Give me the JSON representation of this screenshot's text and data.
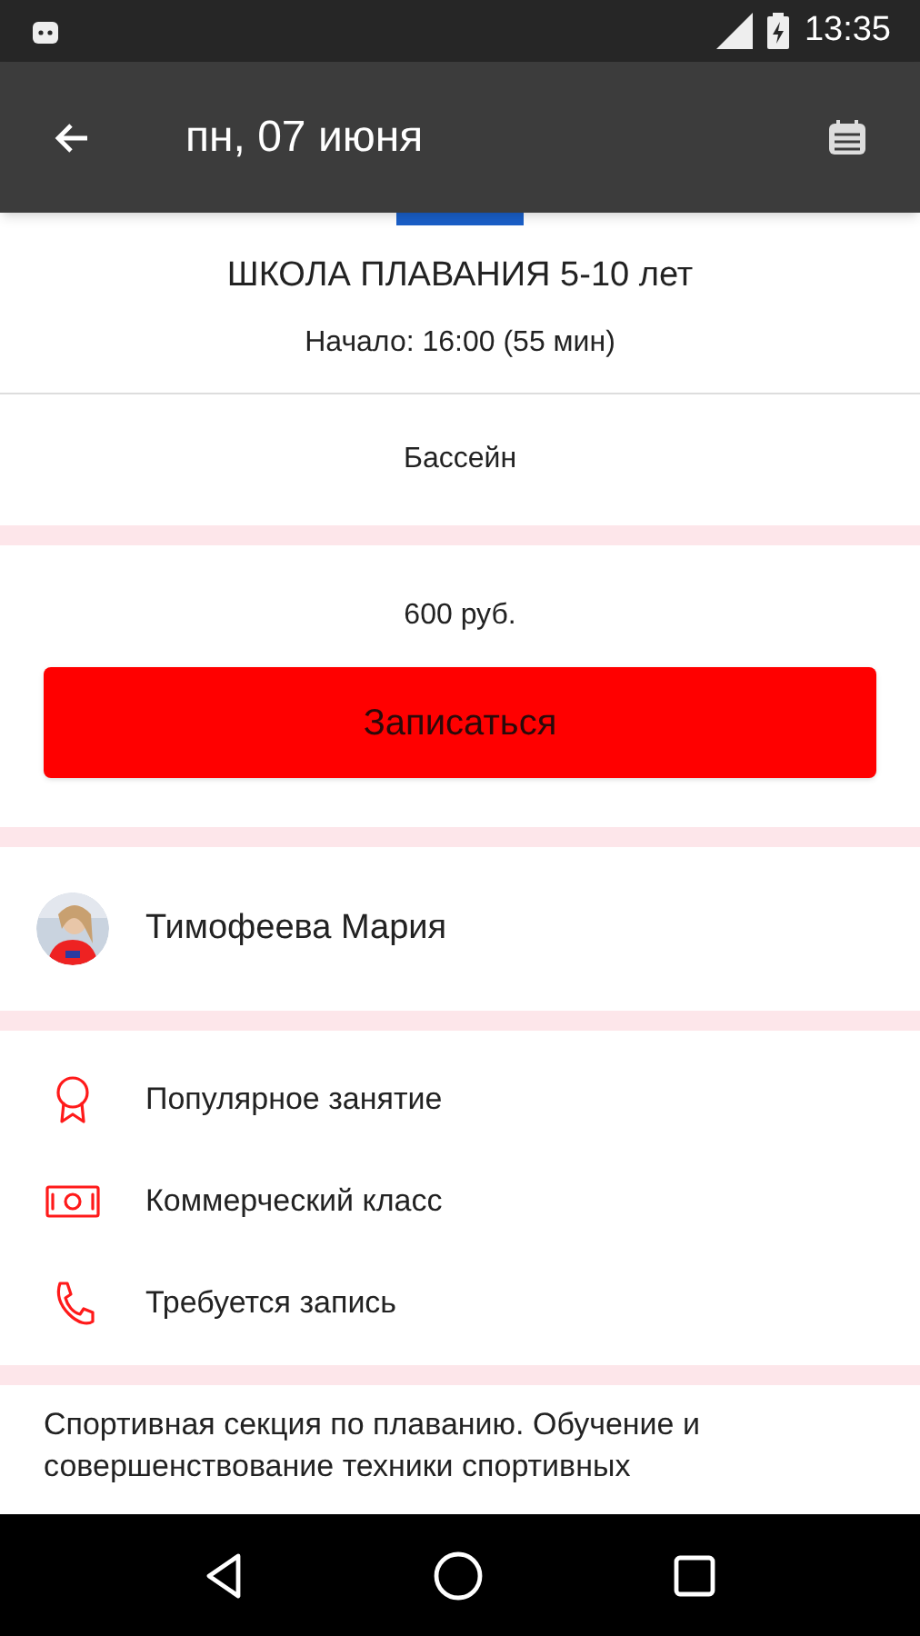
{
  "status_bar": {
    "time": "13:35"
  },
  "app_bar": {
    "title": "пн, 07 июня"
  },
  "event": {
    "title": "ШКОЛА ПЛАВАНИЯ 5-10 лет",
    "start": "Начало: 16:00 (55 мин)",
    "location": "Бассейн"
  },
  "booking": {
    "price": "600 руб.",
    "button": "Записаться"
  },
  "trainer": {
    "name": "Тимофеева Мария"
  },
  "features": [
    {
      "kind": "award",
      "label": "Популярное занятие"
    },
    {
      "kind": "money",
      "label": "Коммерческий класс"
    },
    {
      "kind": "phone",
      "label": "Требуется запись"
    }
  ],
  "description": "Спортивная секция по плаванию. Обучение и совершенствование техники спортивных"
}
